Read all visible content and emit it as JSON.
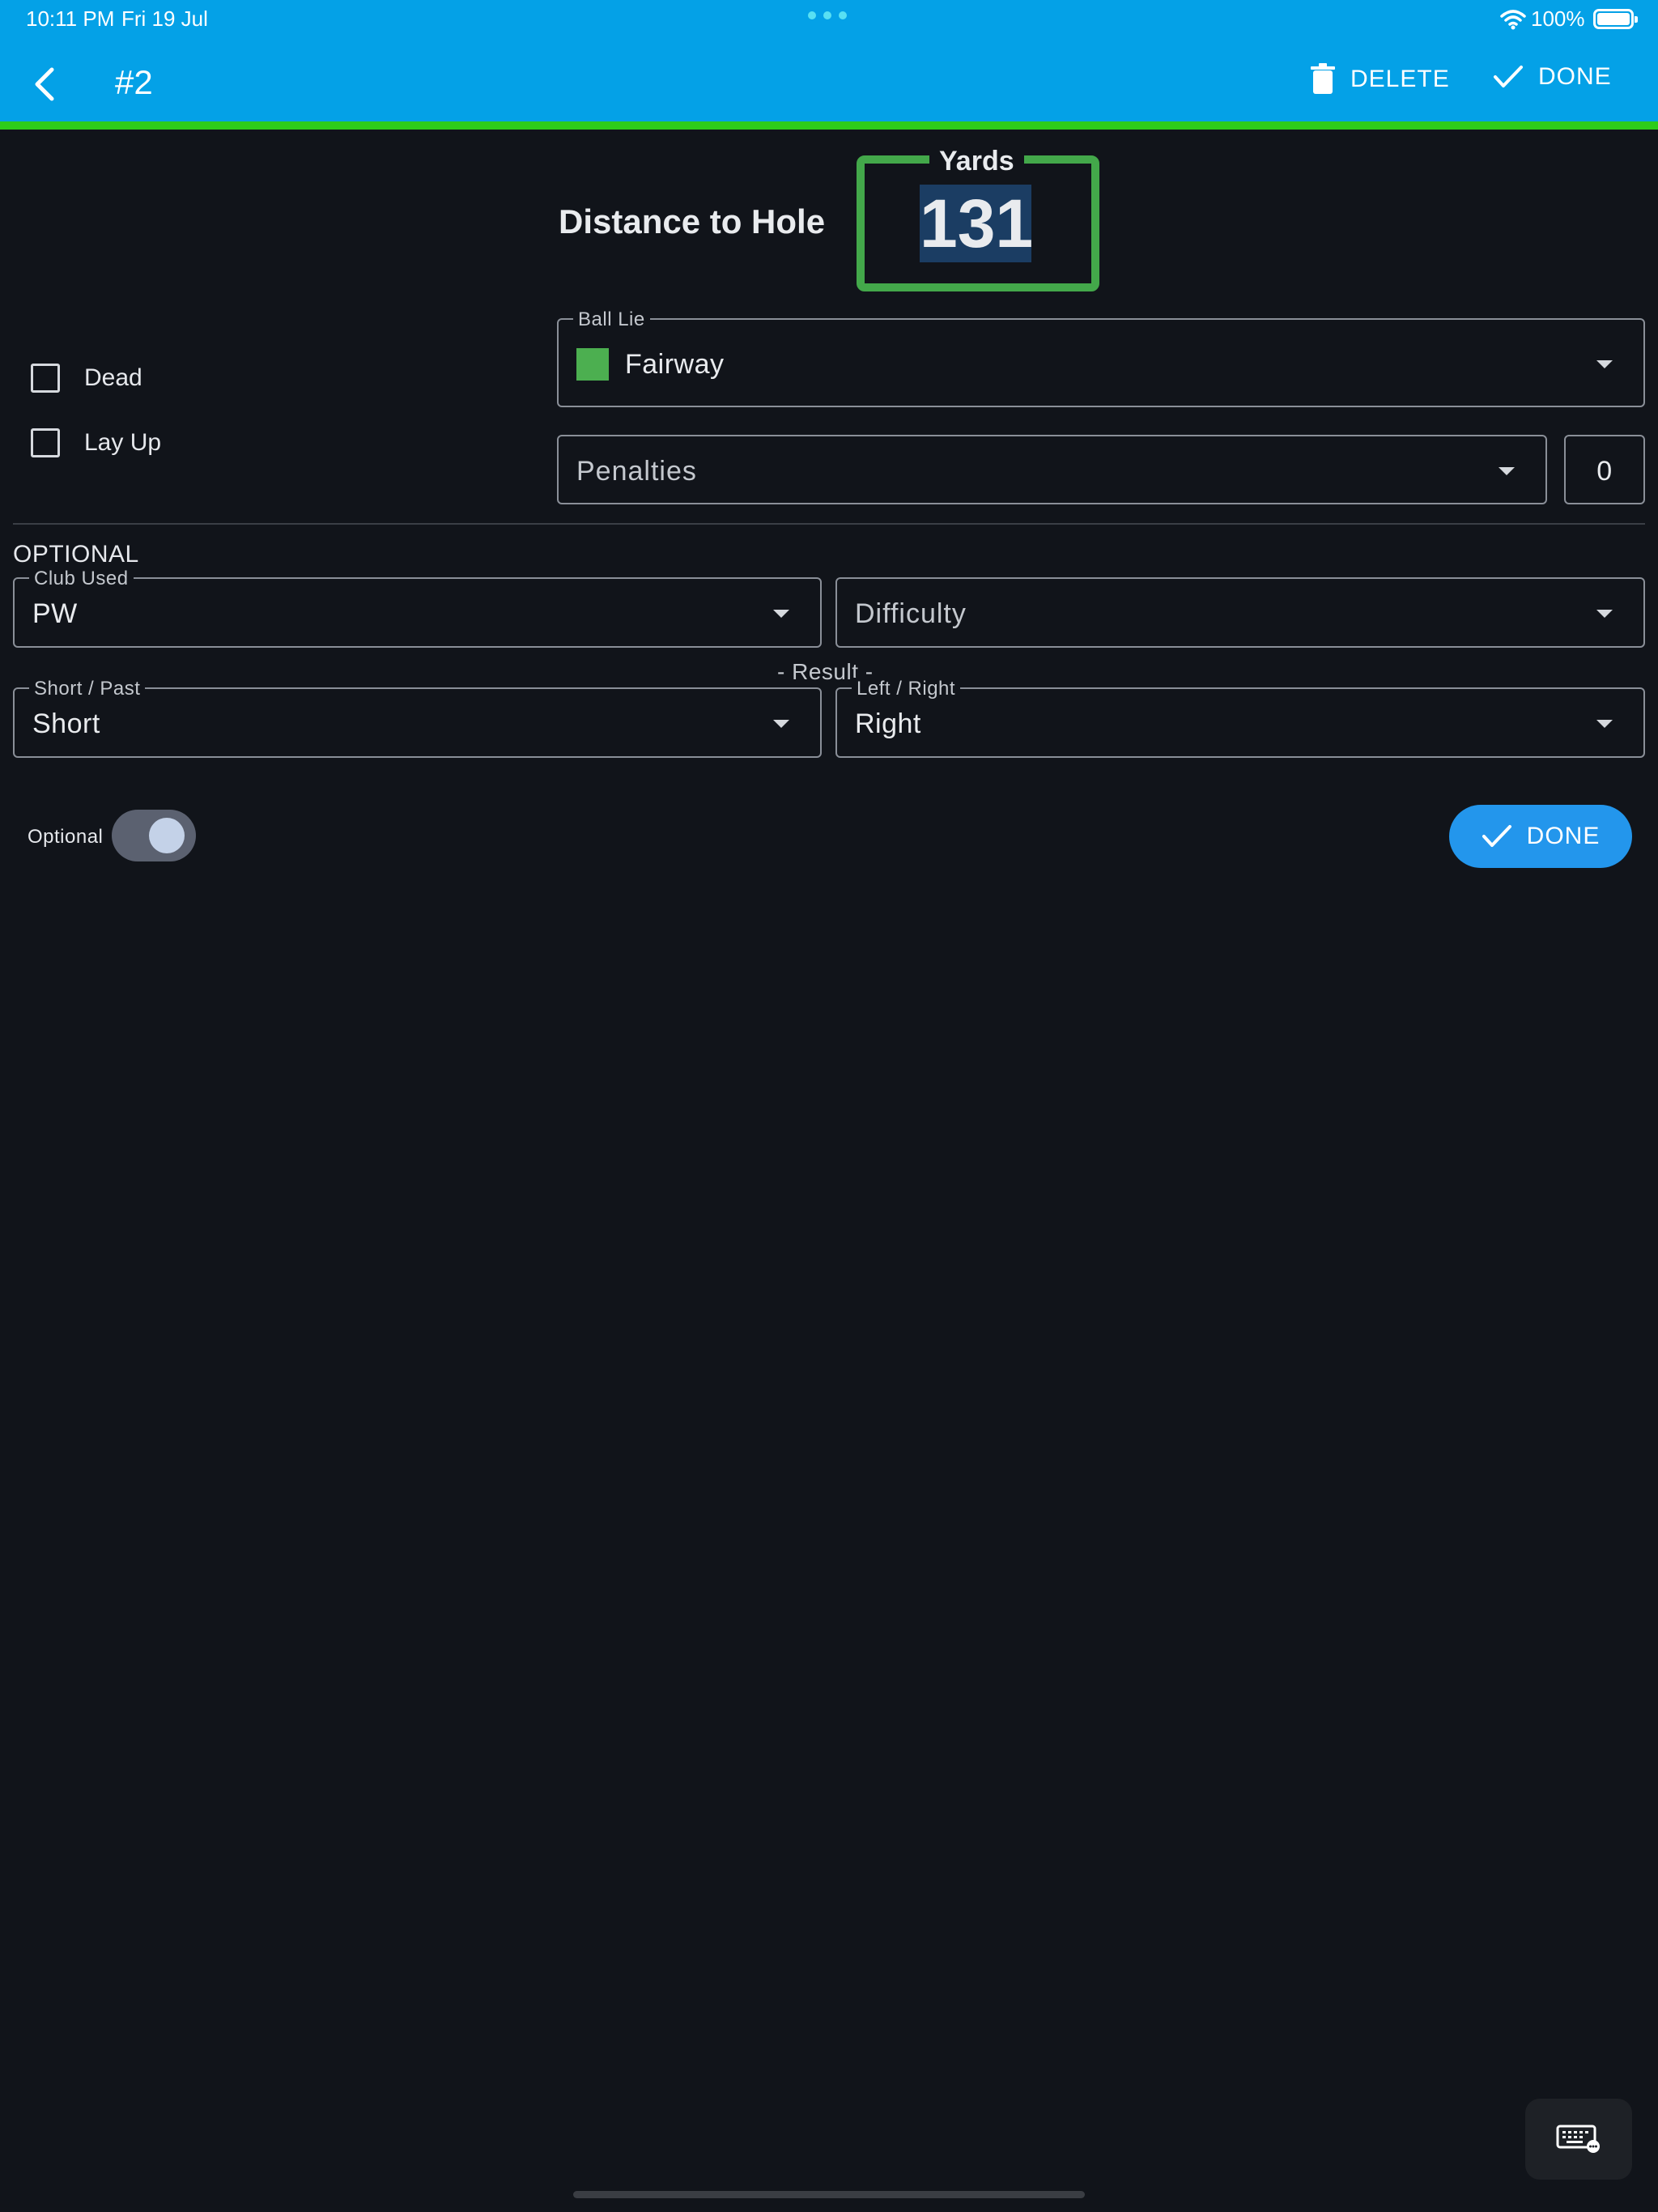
{
  "status_bar": {
    "time": "10:11 PM",
    "date": "Fri 19 Jul",
    "battery": "100%"
  },
  "app_bar": {
    "title": "#2",
    "delete_label": "DELETE",
    "done_label": "DONE",
    "color": "#04a1e7",
    "accent_color": "#2ecc1a"
  },
  "distance": {
    "label": "Distance to Hole",
    "unit_label": "Yards",
    "value": "131"
  },
  "checkboxes": [
    {
      "label": "Dead",
      "checked": false
    },
    {
      "label": "Lay Up",
      "checked": false
    }
  ],
  "ball_lie": {
    "label": "Ball Lie",
    "value": "Fairway",
    "swatch_color": "#4caf50"
  },
  "penalties": {
    "placeholder": "Penalties",
    "count": "0"
  },
  "optional_section": {
    "title": "OPTIONAL",
    "club_used": {
      "label": "Club Used",
      "value": "PW"
    },
    "difficulty": {
      "placeholder": "Difficulty"
    },
    "result_label": "- Result -",
    "short_past": {
      "label": "Short / Past",
      "value": "Short"
    },
    "left_right": {
      "label": "Left / Right",
      "value": "Right"
    }
  },
  "footer": {
    "toggle_label": "Optional",
    "toggle_on": true,
    "done_label": "DONE"
  },
  "icons": [
    "back-chevron-icon",
    "trash-icon",
    "check-icon",
    "wifi-icon",
    "battery-icon",
    "keyboard-icon",
    "dropdown-caret-icon"
  ]
}
